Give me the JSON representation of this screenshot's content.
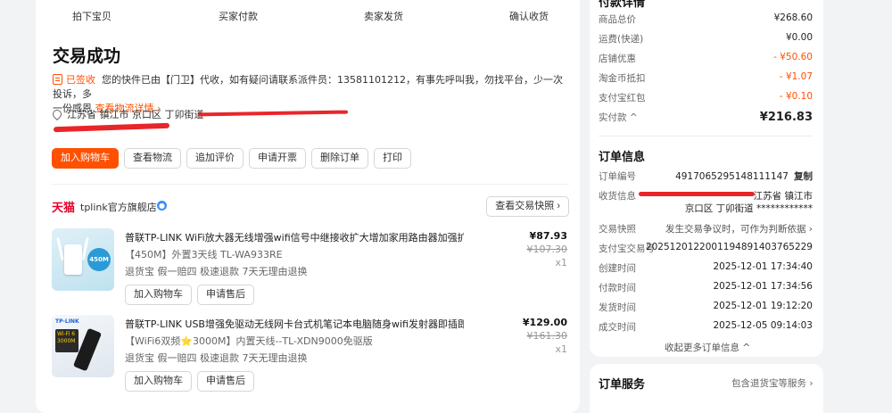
{
  "progress_steps": [
    "拍下宝贝",
    "买家付款",
    "卖家发货",
    "确认收货"
  ],
  "page_title": "交易成功",
  "status": {
    "signed_label": "已签收",
    "message_line1": "您的快件已由【门卫】代收，如有疑问请联系派件员：13581101212，有事先呼叫我，勿找平台，少一次投诉，多",
    "message_line2": "一份感恩",
    "track_link": "查看物流详情 ›"
  },
  "address": {
    "text": "江苏省 镇江市 京口区 丁卯街道"
  },
  "actions": [
    "加入购物车",
    "查看物流",
    "追加评价",
    "申请开票",
    "删除订单",
    "打印"
  ],
  "shop": {
    "platform": "天猫",
    "name": "tplink官方旗舰店",
    "snapshot_button": "查看交易快照 ›"
  },
  "products": [
    {
      "title": "普联TP-LINK WiFi放大器无线增强wifi信号中继接收扩大增加家用路由器加强扩…",
      "spec": "【450M】外置3天线 TL-WA933RE",
      "services": "退货宝 假一赔四 极速退款 7天无理由退换",
      "price": "¥87.93",
      "original_price": "¥107.30",
      "qty": "x1",
      "thumb_badge": "450M",
      "buttons": [
        "加入购物车",
        "申请售后"
      ]
    },
    {
      "title": "普联TP-LINK USB增强免驱动无线网卡台式机笔记本电脑随身wifi发射器即插即…",
      "spec": "【WiFi6双频⭐3000M】内置天线--TL-XDN9000免驱版",
      "services": "退货宝 假一赔四 极速退款 7天无理由退换",
      "price": "¥129.00",
      "original_price": "¥161.30",
      "qty": "x1",
      "thumb_logo": "TP-LINK",
      "thumb_tag": "Wi-Fi 6 3000M",
      "buttons": [
        "加入购物车",
        "申请售后"
      ]
    }
  ],
  "payment": {
    "title": "付款详情",
    "rows": [
      {
        "label": "商品总价",
        "value": "¥268.60"
      },
      {
        "label": "运费(快递)",
        "value": "¥0.00"
      },
      {
        "label": "店铺优惠",
        "value": "- ¥50.60"
      },
      {
        "label": "淘金币抵扣",
        "value": "- ¥1.07"
      },
      {
        "label": "支付宝红包",
        "value": "- ¥0.10"
      }
    ],
    "paid_label": "实付款 ^",
    "paid_value": "¥216.83"
  },
  "order_info": {
    "title": "订单信息",
    "order_no_label": "订单编号",
    "order_no": "4917065295148111147",
    "copy_label": "复制",
    "receiver_label": "收货信息",
    "receiver_line1": "江苏省 镇江市",
    "receiver_line2": "京口区 丁卯街道 ************",
    "snapshot_label": "交易快照",
    "snapshot_value": "发生交易争议时，可作为判断依据 ›",
    "alipay_label": "支付宝交易号",
    "alipay_value": "2025120122001194891403765229",
    "times": [
      {
        "label": "创建时间",
        "value": "2025-12-01 17:34:40"
      },
      {
        "label": "付款时间",
        "value": "2025-12-01 17:34:56"
      },
      {
        "label": "发货时间",
        "value": "2025-12-01 19:12:20"
      },
      {
        "label": "成交时间",
        "value": "2025-12-05 09:14:03"
      }
    ],
    "collapse_link": "收起更多订单信息 ^"
  },
  "order_service": {
    "title": "订单服务",
    "link": "包含退货宝等服务 ›"
  },
  "colors": {
    "accent": "#ff5000",
    "tmall": "#e4002b",
    "redaction": "#e8262a"
  }
}
